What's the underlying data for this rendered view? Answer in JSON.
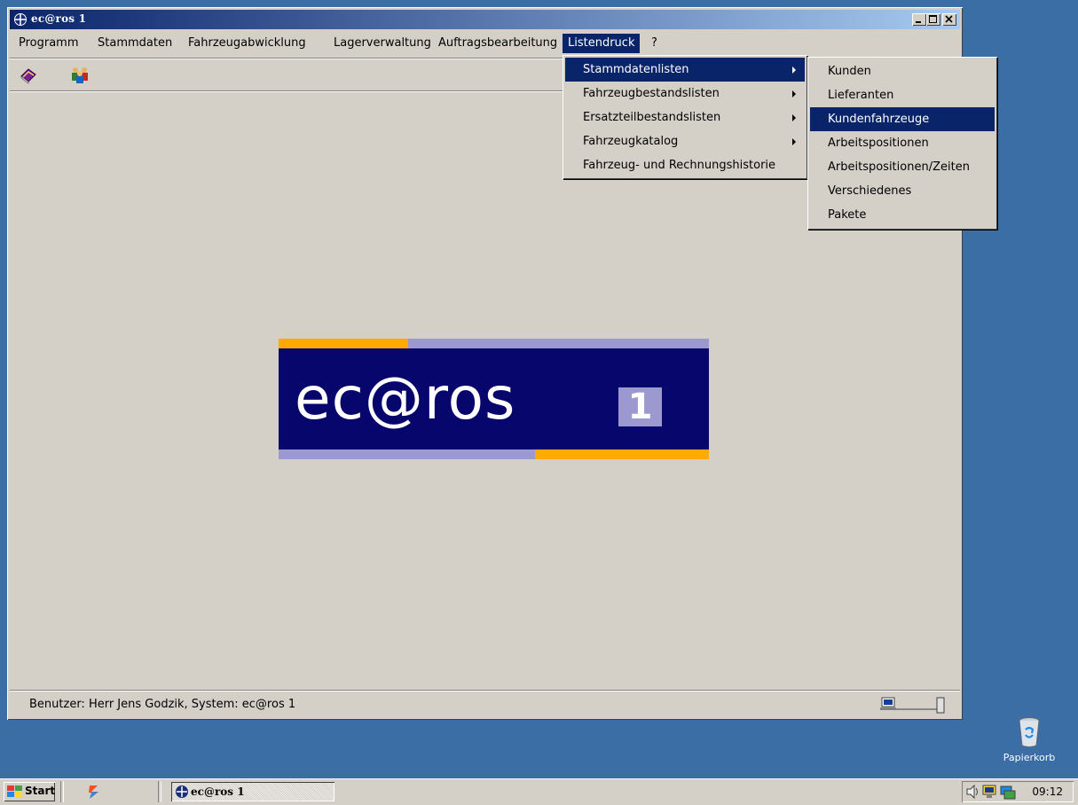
{
  "window": {
    "title": "ec@ros 1",
    "controls": [
      "minimize",
      "maximize",
      "close"
    ]
  },
  "menubar": {
    "items": [
      {
        "label": "Programm"
      },
      {
        "label": "Stammdaten"
      },
      {
        "label": "Fahrzeugabwicklung"
      },
      {
        "label": "Lagerverwaltung"
      },
      {
        "label": "Auftragsbearbeitung"
      },
      {
        "label": "Listendruck",
        "active": true
      },
      {
        "label": "?"
      }
    ]
  },
  "toolbar": {
    "buttons": [
      {
        "icon": "book-icon"
      },
      {
        "icon": "people-icon"
      }
    ]
  },
  "listendruck_menu": {
    "items": [
      {
        "label": "Stammdatenlisten",
        "submenu": true,
        "highlighted": true
      },
      {
        "label": "Fahrzeugbestandslisten",
        "submenu": true
      },
      {
        "label": "Ersatzteilbestandslisten",
        "submenu": true
      },
      {
        "label": "Fahrzeugkatalog",
        "submenu": true
      },
      {
        "label": "Fahrzeug- und Rechnungshistorie",
        "submenu": false
      }
    ]
  },
  "stammdatenlisten_submenu": {
    "items": [
      {
        "label": "Kunden"
      },
      {
        "label": "Lieferanten"
      },
      {
        "label": "Kundenfahrzeuge",
        "highlighted": true
      },
      {
        "label": "Arbeitspositionen"
      },
      {
        "label": "Arbeitspositionen/Zeiten"
      },
      {
        "label": "Verschiedenes"
      },
      {
        "label": "Pakete"
      }
    ]
  },
  "logo": {
    "word": "ec@ros",
    "number": "1",
    "colors": {
      "background": "#06066C",
      "orange": "#FFAA00",
      "lavender": "#9C99D0"
    }
  },
  "statusbar": {
    "text": "Benutzer: Herr Jens Godzik, System: ec@ros 1"
  },
  "desktop": {
    "recycle_bin_label": "Papierkorb"
  },
  "taskbar": {
    "start_label": "Start",
    "task_label": "ec@ros 1",
    "clock": "09:12"
  },
  "colors": {
    "desktop": "#3A6EA5",
    "window_face": "#D4D0C8",
    "selection": "#0A246A"
  }
}
